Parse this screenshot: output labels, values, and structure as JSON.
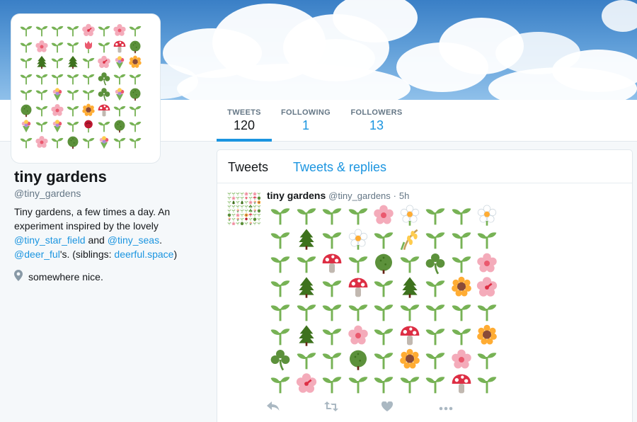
{
  "profile": {
    "name": "tiny gardens",
    "handle": "@tiny_gardens",
    "bio_line1": "Tiny gardens, a few times a day. An experiment inspired by the lovely ",
    "bio_link1": "@tiny_star_field",
    "bio_and": " and ",
    "bio_link2": "@tiny_seas",
    "bio_period": ".",
    "bio_link3": "@deer_ful",
    "bio_mid": "'s. (siblings: ",
    "bio_link4": "deerful.space",
    "bio_end": ")",
    "location": "somewhere nice.",
    "location_icon": "map-pin-icon"
  },
  "stats": [
    {
      "label": "TWEETS",
      "value": "120",
      "active": true
    },
    {
      "label": "FOLLOWING",
      "value": "1",
      "active": false
    },
    {
      "label": "FOLLOWERS",
      "value": "13",
      "active": false
    }
  ],
  "tabs": {
    "tweets": "Tweets",
    "replies": "Tweets & replies"
  },
  "tweet": {
    "name": "tiny gardens",
    "handle": "@tiny_gardens",
    "dot": "·",
    "time": "5h",
    "garden": [
      [
        "sprout",
        "sprout",
        "sprout",
        "sprout",
        "blossom",
        "daisy",
        "sprout",
        "sprout",
        "daisy"
      ],
      [
        "sprout",
        "tree",
        "sprout",
        "daisy",
        "sprout",
        "rice",
        "sprout",
        "sprout",
        "sprout"
      ],
      [
        "sprout",
        "sprout",
        "mushroom",
        "sprout",
        "bush",
        "sprout",
        "shamrock",
        "sprout",
        "blossom"
      ],
      [
        "sprout",
        "tree",
        "sprout",
        "mushroom",
        "sprout",
        "tree",
        "sprout",
        "sunflower",
        "hibiscus"
      ],
      [
        "sprout",
        "sprout",
        "sprout",
        "sprout",
        "sprout",
        "sprout",
        "sprout",
        "sprout",
        "sprout"
      ],
      [
        "sprout",
        "tree",
        "sprout",
        "blossom",
        "sprout",
        "mushroom",
        "sprout",
        "sprout",
        "sunflower"
      ],
      [
        "shamrock",
        "sprout",
        "sprout",
        "bush",
        "sprout",
        "sunflower",
        "sprout",
        "blossom",
        "sprout"
      ],
      [
        "sprout",
        "hibiscus",
        "sprout",
        "sprout",
        "sprout",
        "sprout",
        "sprout",
        "mushroom",
        "sprout"
      ]
    ],
    "actions": [
      "reply-icon",
      "retweet-icon",
      "like-icon",
      "more-icon"
    ]
  },
  "avatar_garden": [
    [
      "sprout",
      "sprout",
      "sprout",
      "sprout",
      "hibiscus",
      "sprout",
      "blossom",
      "sprout"
    ],
    [
      "sprout",
      "blossom",
      "sprout",
      "sprout",
      "tulip",
      "sprout",
      "mushroom",
      "bush"
    ],
    [
      "sprout",
      "tree",
      "sprout",
      "tree",
      "sprout",
      "hibiscus",
      "bouquet",
      "sunflower"
    ],
    [
      "sprout",
      "sprout",
      "sprout",
      "sprout",
      "sprout",
      "shamrock",
      "sprout",
      "sprout"
    ],
    [
      "sprout",
      "sprout",
      "bouquet",
      "sprout",
      "sprout",
      "shamrock",
      "bouquet",
      "bush"
    ],
    [
      "bush",
      "sprout",
      "blossom",
      "sprout",
      "sunflower",
      "mushroom",
      "sprout",
      "sprout"
    ],
    [
      "bouquet",
      "sprout",
      "bouquet",
      "sprout",
      "rose",
      "sprout",
      "bush",
      "sprout"
    ],
    [
      "sprout",
      "blossom",
      "sprout",
      "bush",
      "sprout",
      "bouquet",
      "sprout",
      "sprout"
    ]
  ],
  "colors": {
    "accent": "#1b95e0",
    "text": "#14171a",
    "muted": "#657786",
    "background": "#f5f8fa",
    "sky": "#5a9ad6"
  }
}
